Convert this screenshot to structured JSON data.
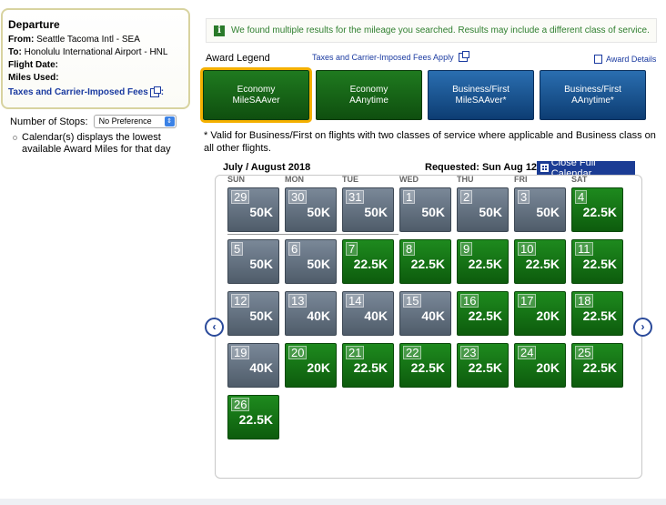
{
  "departure": {
    "title": "Departure",
    "from_label": "From:",
    "from_value": "Seattle Tacoma Intl - SEA",
    "to_label": "To:",
    "to_value": "Honolulu International Airport - HNL",
    "flight_date_label": "Flight Date:",
    "miles_used_label": "Miles Used:",
    "taxes_link": "Taxes and Carrier-Imposed Fees",
    "taxes_suffix": ":"
  },
  "stops": {
    "label": "Number of Stops:",
    "selected": "No Preference"
  },
  "calendar_note": "Calendar(s) displays the lowest available Award Miles for that day",
  "banner": {
    "icon": "i",
    "message": "We found multiple results for the mileage you searched. Results may include a different class of service."
  },
  "legend": {
    "label": "Award Legend",
    "taxes_link": "Taxes and Carrier-Imposed Fees Apply",
    "details_link": "Award Details"
  },
  "award_types": [
    {
      "line1": "Economy",
      "line2": "MileSAAver",
      "color": "green",
      "selected": true
    },
    {
      "line1": "Economy",
      "line2": "AAnytime",
      "color": "green",
      "selected": false
    },
    {
      "line1": "Business/First",
      "line2": "MileSAAver*",
      "color": "blue",
      "selected": false
    },
    {
      "line1": "Business/First",
      "line2": "AAnytime*",
      "color": "blue",
      "selected": false
    }
  ],
  "valid_note": "* Valid for Business/First on flights with two classes of service where applicable and Business class on all other flights.",
  "calendar": {
    "month_title": "July / August 2018",
    "requested": "Requested: Sun Aug 12",
    "close_button": "Close Full Calendar",
    "days_of_week": [
      "SUN",
      "MON",
      "TUE",
      "WED",
      "THU",
      "FRI",
      "SAT"
    ],
    "weeks": [
      [
        {
          "d": "29",
          "m": "50K",
          "c": "gray"
        },
        {
          "d": "30",
          "m": "50K",
          "c": "gray"
        },
        {
          "d": "31",
          "m": "50K",
          "c": "gray"
        },
        {
          "d": "1",
          "m": "50K",
          "c": "gray"
        },
        {
          "d": "2",
          "m": "50K",
          "c": "gray"
        },
        {
          "d": "3",
          "m": "50K",
          "c": "gray"
        },
        {
          "d": "4",
          "m": "22.5K",
          "c": "green"
        }
      ],
      [
        {
          "d": "5",
          "m": "50K",
          "c": "gray"
        },
        {
          "d": "6",
          "m": "50K",
          "c": "gray"
        },
        {
          "d": "7",
          "m": "22.5K",
          "c": "green"
        },
        {
          "d": "8",
          "m": "22.5K",
          "c": "green"
        },
        {
          "d": "9",
          "m": "22.5K",
          "c": "green"
        },
        {
          "d": "10",
          "m": "22.5K",
          "c": "green"
        },
        {
          "d": "11",
          "m": "22.5K",
          "c": "green"
        }
      ],
      [
        {
          "d": "12",
          "m": "50K",
          "c": "gray"
        },
        {
          "d": "13",
          "m": "40K",
          "c": "gray"
        },
        {
          "d": "14",
          "m": "40K",
          "c": "gray"
        },
        {
          "d": "15",
          "m": "40K",
          "c": "gray"
        },
        {
          "d": "16",
          "m": "22.5K",
          "c": "green"
        },
        {
          "d": "17",
          "m": "20K",
          "c": "green"
        },
        {
          "d": "18",
          "m": "22.5K",
          "c": "green"
        }
      ],
      [
        {
          "d": "19",
          "m": "40K",
          "c": "gray"
        },
        {
          "d": "20",
          "m": "20K",
          "c": "green"
        },
        {
          "d": "21",
          "m": "22.5K",
          "c": "green"
        },
        {
          "d": "22",
          "m": "22.5K",
          "c": "green"
        },
        {
          "d": "23",
          "m": "22.5K",
          "c": "green"
        },
        {
          "d": "24",
          "m": "20K",
          "c": "green"
        },
        {
          "d": "25",
          "m": "22.5K",
          "c": "green"
        }
      ],
      [
        {
          "d": "26",
          "m": "22.5K",
          "c": "green"
        }
      ]
    ],
    "prev_icon": "chevron-left-icon",
    "next_icon": "chevron-right-icon"
  },
  "colors": {
    "green": "#0d5c0d",
    "gray": "#4f5c6a",
    "link": "#1a3aa0",
    "highlight": "#f4b000"
  }
}
